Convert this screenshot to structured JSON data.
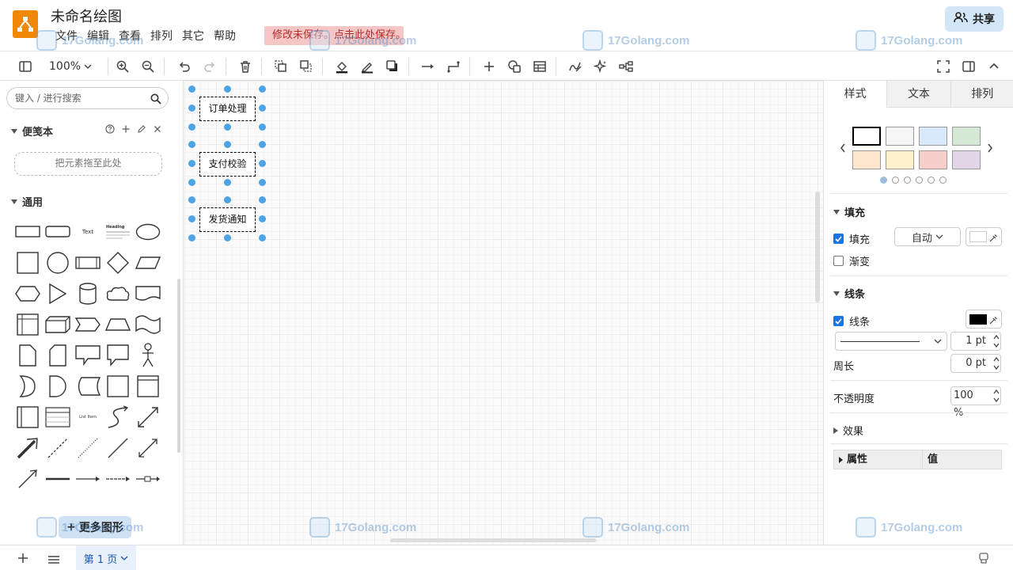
{
  "app": {
    "title": "未命名绘图",
    "menu": [
      "文件",
      "编辑",
      "查看",
      "排列",
      "其它",
      "帮助"
    ],
    "unsaved_notice": "修改未保存。点击此处保存。",
    "share_label": "共享"
  },
  "toolbar": {
    "zoom": "100%"
  },
  "left_panel": {
    "search_placeholder": "键入 / 进行搜索",
    "scratchpad_title": "便笺本",
    "dropzone_text": "把元素拖至此处",
    "general_title": "通用",
    "shape_texts": {
      "text": "Text",
      "heading": "Heading",
      "list_item": "List Item"
    },
    "more_shapes_label": "更多图形"
  },
  "canvas": {
    "nodes": [
      "订单处理",
      "支付校验",
      "发货通知"
    ]
  },
  "right_panel": {
    "tabs": [
      "样式",
      "文本",
      "排列"
    ],
    "swatches": [
      "#ffffff",
      "#f5f5f5",
      "#dae8fc",
      "#d5e8d4",
      "#ffe6cc",
      "#fff2cc",
      "#f8cecc",
      "#e1d5e7"
    ],
    "fill_section": "填充",
    "fill_label": "填充",
    "fill_mode": "自动",
    "gradient_label": "渐变",
    "line_section": "线条",
    "line_label": "线条",
    "line_color": "#000000",
    "line_width": "1 pt",
    "perimeter_label": "周长",
    "perimeter_value": "0 pt",
    "opacity_label": "不透明度",
    "opacity_value": "100 %",
    "effects_label": "效果",
    "prop_col": "属性",
    "value_col": "值"
  },
  "footer": {
    "page_label": "第 1 页"
  },
  "watermark": {
    "text": "17Golang.com"
  }
}
